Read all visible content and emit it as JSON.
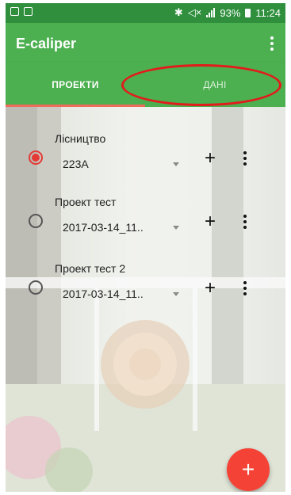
{
  "status_bar": {
    "battery": "93%",
    "time": "11:24"
  },
  "app_bar": {
    "title": "E-caliper",
    "menu_icon": "overflow-menu-icon"
  },
  "tabs": [
    {
      "label": "ПРОЕКТИ",
      "selected": true
    },
    {
      "label": "ДАНІ",
      "selected": false
    }
  ],
  "projects": [
    {
      "title": "Лісництво",
      "value": "223А",
      "selected": true
    },
    {
      "title": "Проект тест",
      "value": "2017-03-14_11..",
      "selected": false
    },
    {
      "title": "Проект тест 2",
      "value": "2017-03-14_11..",
      "selected": false
    }
  ],
  "fab": {
    "label": "+"
  },
  "row_add_label": "+",
  "colors": {
    "primary": "#4caf50",
    "status_bar": "#2f8f3d",
    "accent": "#f44336",
    "tab_indicator": "#f06c5a",
    "annotation": "#e31b1b"
  }
}
